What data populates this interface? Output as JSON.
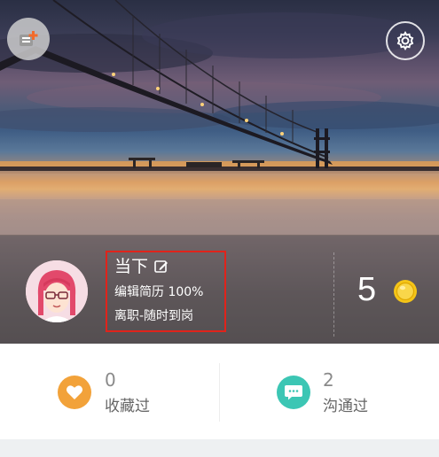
{
  "profile": {
    "name": "当下",
    "resume_text": "编辑简历 100%",
    "status_text": "离职-随时到岗",
    "coins": "5"
  },
  "stats": {
    "favorites": {
      "count": "0",
      "label": "收藏过"
    },
    "contacted": {
      "count": "2",
      "label": "沟通过"
    }
  },
  "icons": {
    "top_left": "switch-identity-icon",
    "top_right": "settings-gear-icon",
    "edit": "edit-pencil-icon",
    "coin": "gold-coin-icon",
    "favorites": "heart-icon",
    "contacted": "chat-bubble-icon"
  },
  "colors": {
    "highlight_box": "#e0231b",
    "favorites_icon_bg": "#f2a23a",
    "contacted_icon_bg": "#3cc6b4",
    "coin": "#f5c518"
  }
}
